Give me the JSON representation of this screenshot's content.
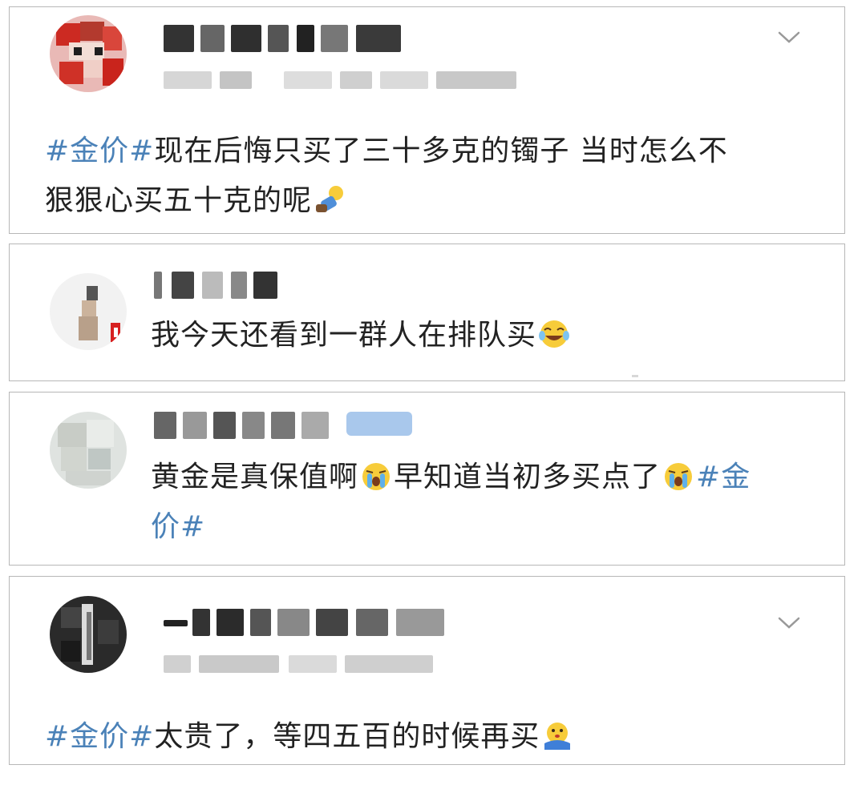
{
  "posts": [
    {
      "has_menu": true,
      "segments": [
        {
          "t": "tag",
          "v": "#金价#"
        },
        {
          "t": "text",
          "v": "现在后悔只买了三十多克的镯子 当时怎么不"
        }
      ],
      "line2": "狠狠心买五十克的呢",
      "emoji_line1": [],
      "emoji_line2": [
        "kneel-emoji"
      ]
    },
    {
      "has_menu": false,
      "text": "我今天还看到一群人在排队买",
      "emoji": [
        "laugh-cry-emoji"
      ]
    },
    {
      "has_menu": false,
      "part1": "黄金是真保值啊",
      "part2": "早知道当初多买点了",
      "tag_start": "#金",
      "tag_end": "价#",
      "emoji": [
        "crying-emoji",
        "crying-emoji"
      ]
    },
    {
      "has_menu": true,
      "tag": "#金价#",
      "text": "太贵了，等四五百的时候再买",
      "emoji": [
        "wrapped-emoji"
      ]
    }
  ],
  "colors": {
    "hashtag": "#4b82b8",
    "text": "#222222",
    "border": "#b7b7b7"
  }
}
